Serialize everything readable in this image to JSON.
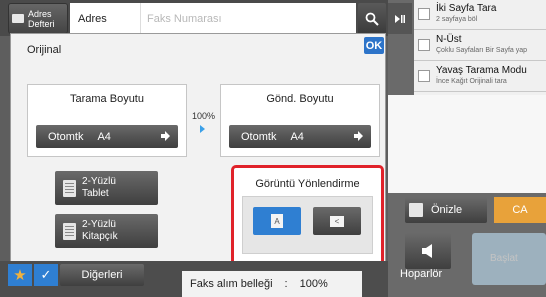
{
  "topbar": {
    "address_book_label": "Adres\nDefteri",
    "address_label": "Adres",
    "fax_placeholder": "Faks Numarası",
    "search_icon": "search-icon"
  },
  "dialog": {
    "title": "Orijinal",
    "ok_label": "OK",
    "scan_size": {
      "title": "Tarama Boyutu",
      "value_mode": "Otomtk",
      "value_size": "A4"
    },
    "ratio": "100%",
    "send_size": {
      "title": "Gönd. Boyutu",
      "value_mode": "Otomtk",
      "value_size": "A4"
    },
    "duplex_tablet": "2-Yüzlü\nTablet",
    "duplex_booklet": "2-Yüzlü\nKitapçık",
    "orientation": {
      "title": "Görüntü Yönlendirme",
      "selected": "portrait"
    }
  },
  "bottom": {
    "others_label": "Diğerleri",
    "memory_label": "Faks alım belleği",
    "memory_sep": ":",
    "memory_value": "100%"
  },
  "right": {
    "items": [
      {
        "title": "İki Sayfa Tara",
        "subtitle": "2 sayfaya böl"
      },
      {
        "title": "N-Üst",
        "subtitle": "Çoklu Sayfaları Bir Sayfa yap"
      },
      {
        "title": "Yavaş Tarama Modu",
        "subtitle": "İnce Kağıt Orijinali tara"
      }
    ],
    "preview_label": "Önizle",
    "ca_label": "CA",
    "speaker_label": "Hoparlör",
    "send_label": "Başlat"
  },
  "colors": {
    "accent_blue": "#2f7fd2",
    "highlight_red": "#e0222a",
    "ca_orange": "#e8a23a"
  }
}
